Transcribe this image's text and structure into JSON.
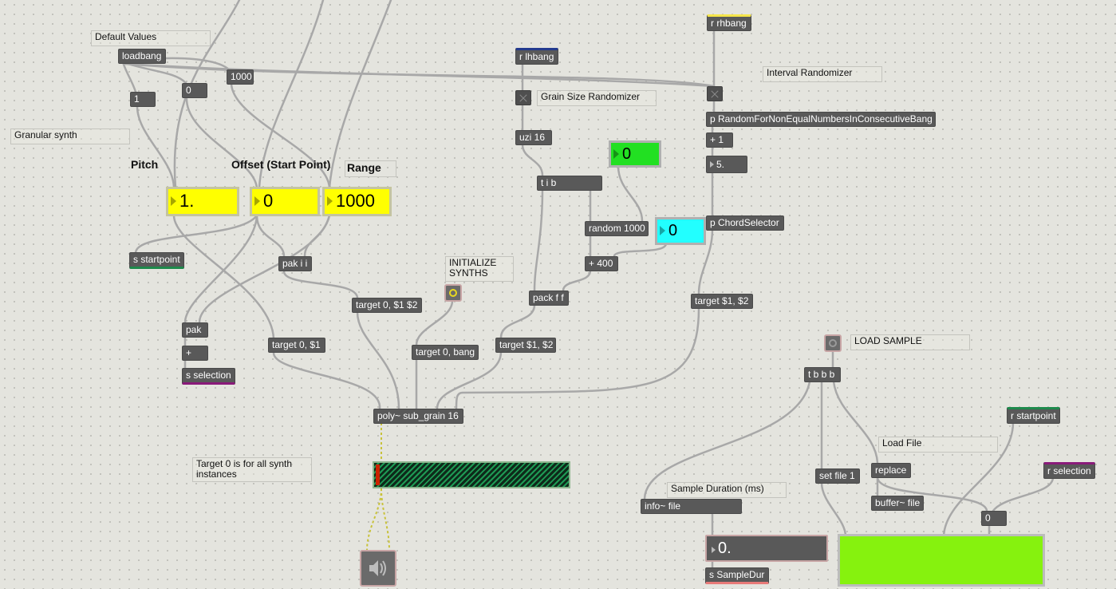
{
  "colors": {
    "background": "#e4e4de",
    "object": "#595959",
    "number_box_yellow": "#ffff00",
    "number_box_green": "#22e022",
    "number_box_cyan": "#22ffff",
    "waveform": "#86f20e"
  },
  "comments": {
    "default_values": "Default Values",
    "granular_synth": "Granular synth",
    "pitch": "Pitch",
    "offset": "Offset (Start Point)",
    "range": "Range",
    "grain_size_randomizer": "Grain Size Randomizer",
    "interval_randomizer": "Interval Randomizer",
    "initialize_synths": "INITIALIZE SYNTHS",
    "load_sample": "LOAD SAMPLE",
    "load_file": "Load File",
    "sample_duration": "Sample Duration (ms)",
    "target_note": "Target 0 is for all synth instances"
  },
  "objects": {
    "loadbang": "loadbang",
    "msg_1": "1",
    "msg_0": "0",
    "msg_1000": "1000",
    "r_lhbang": "r lhbang",
    "uzi": "uzi 16",
    "t_i_b": "t i b",
    "random": "random 1000",
    "plus_400": "+ 400",
    "pack_ff": "pack f f",
    "target_12_left": "target $1, $2",
    "target_12_right": "target $1, $2",
    "r_rhbang": "r rhbang",
    "p_random": "p RandomForNonEqualNumbersInConsecutiveBang",
    "plus_1": "+ 1",
    "float_5": "5.",
    "p_chord": "p ChordSelector",
    "s_startpoint": "s startpoint",
    "pak_ii": "pak i i",
    "target_0_12": "target 0, $1 $2",
    "target_0_1": "target 0, $1",
    "target_0_bang": "target 0, bang",
    "pak": "pak",
    "plus": "+",
    "s_selection": "s selection",
    "poly": "poly~ sub_grain 16",
    "t_bbb": "t b b b",
    "r_startpoint": "r startpoint",
    "r_selection": "r selection",
    "replace": "replace",
    "buffer_file": "buffer~ file",
    "set_file": "set file 1",
    "info_file": "info~ file",
    "msg_0b": "0",
    "s_sampledur": "s SampleDur"
  },
  "number_boxes": {
    "pitch": "1.",
    "offset": "0",
    "range": "1000",
    "green": "0",
    "cyan": "0",
    "sample_dur": "0."
  },
  "icons": {
    "speaker": "speaker-icon",
    "meter": "level-meter",
    "waveform": "waveform-display"
  }
}
